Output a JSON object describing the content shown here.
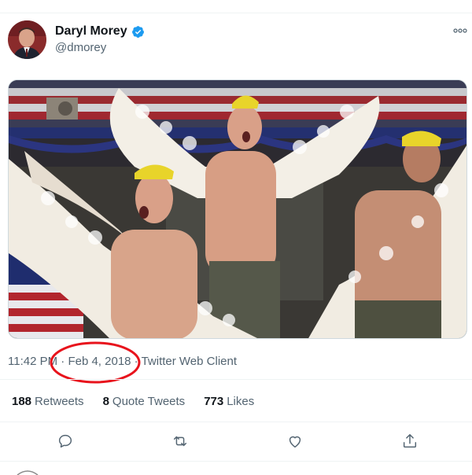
{
  "author": {
    "name": "Daryl Morey",
    "handle": "@dmorey",
    "verified": true,
    "avatar_icon": "profile-photo"
  },
  "tweet": {
    "time": "11:42 PM",
    "separator": "·",
    "date": "Feb 4, 2018",
    "source": "Twitter Web Client",
    "media_icon": "photo-three-shirtless-men-with-feathered-wings"
  },
  "stats": [
    {
      "count": "188",
      "label": "Retweets"
    },
    {
      "count": "8",
      "label": "Quote Tweets"
    },
    {
      "count": "773",
      "label": "Likes"
    }
  ],
  "actions": [
    "reply-icon",
    "retweet-icon",
    "like-icon",
    "share-icon"
  ],
  "colors": {
    "verified": "#1d9bf0",
    "annotation_circle": "#e8131c",
    "secondary_text": "#536471"
  }
}
